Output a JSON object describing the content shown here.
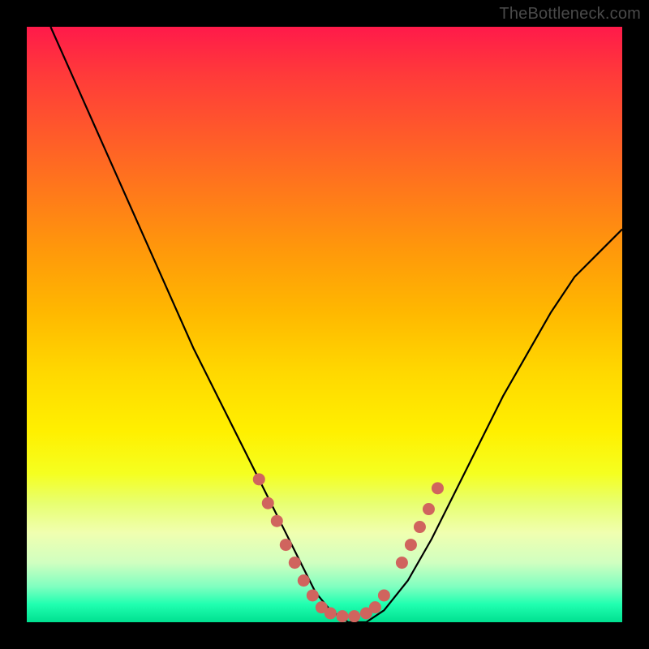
{
  "watermark": "TheBottleneck.com",
  "chart_data": {
    "type": "line",
    "title": "",
    "xlabel": "",
    "ylabel": "",
    "xlim": [
      0,
      100
    ],
    "ylim": [
      0,
      100
    ],
    "series": [
      {
        "name": "curve",
        "x": [
          4,
          8,
          12,
          16,
          20,
          24,
          28,
          32,
          36,
          40,
          43,
          46,
          48.5,
          51,
          54,
          57,
          60,
          64,
          68,
          72,
          76,
          80,
          84,
          88,
          92,
          96,
          100
        ],
        "y": [
          100,
          91,
          82,
          73,
          64,
          55,
          46,
          38,
          30,
          22,
          16,
          10,
          5,
          2,
          0,
          0,
          2,
          7,
          14,
          22,
          30,
          38,
          45,
          52,
          58,
          62,
          66
        ],
        "color": "#000000"
      }
    ],
    "markers": [
      {
        "x": 39,
        "y": 24,
        "color": "#d0645e"
      },
      {
        "x": 40.5,
        "y": 20,
        "color": "#d0645e"
      },
      {
        "x": 42,
        "y": 17,
        "color": "#d0645e"
      },
      {
        "x": 43.5,
        "y": 13,
        "color": "#d0645e"
      },
      {
        "x": 45,
        "y": 10,
        "color": "#d0645e"
      },
      {
        "x": 46.5,
        "y": 7,
        "color": "#d0645e"
      },
      {
        "x": 48,
        "y": 4.5,
        "color": "#d0645e"
      },
      {
        "x": 49.5,
        "y": 2.5,
        "color": "#d0645e"
      },
      {
        "x": 51,
        "y": 1.5,
        "color": "#d0645e"
      },
      {
        "x": 53,
        "y": 1,
        "color": "#d0645e"
      },
      {
        "x": 55,
        "y": 1,
        "color": "#d0645e"
      },
      {
        "x": 57,
        "y": 1.5,
        "color": "#d0645e"
      },
      {
        "x": 58.5,
        "y": 2.5,
        "color": "#d0645e"
      },
      {
        "x": 60,
        "y": 4.5,
        "color": "#d0645e"
      },
      {
        "x": 63,
        "y": 10,
        "color": "#d0645e"
      },
      {
        "x": 64.5,
        "y": 13,
        "color": "#d0645e"
      },
      {
        "x": 66,
        "y": 16,
        "color": "#d0645e"
      },
      {
        "x": 67.5,
        "y": 19,
        "color": "#d0645e"
      },
      {
        "x": 69,
        "y": 22.5,
        "color": "#d0645e"
      }
    ],
    "background_gradient": {
      "top": "#ff1a4a",
      "middle": "#ffd800",
      "bottom": "#00e090"
    }
  }
}
